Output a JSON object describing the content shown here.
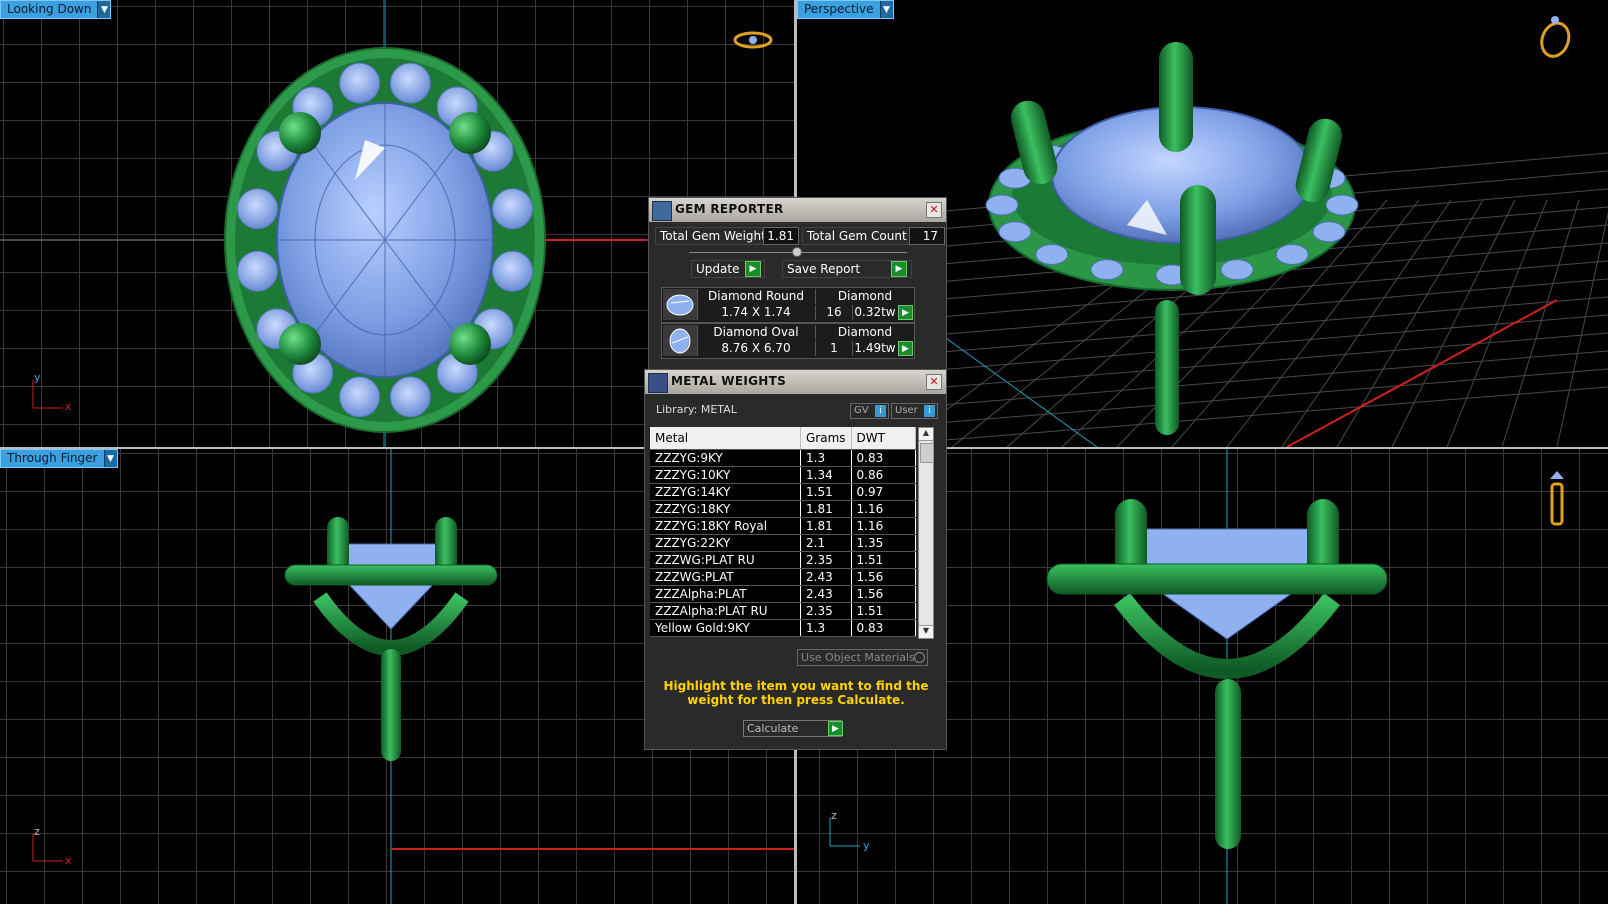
{
  "viewports": {
    "top_left": {
      "label": "Looking Down",
      "axes": [
        "y",
        "x"
      ]
    },
    "top_right": {
      "label": "Perspective"
    },
    "bottom_left": {
      "label": "Through Finger",
      "axes": [
        "z",
        "x"
      ]
    },
    "bottom_right": {
      "axes": [
        "z",
        "y"
      ]
    }
  },
  "gem_reporter": {
    "title": "GEM REPORTER",
    "total_weight_label": "Total Gem Weight",
    "total_weight_value": "1.81",
    "total_count_label": "Total Gem Count",
    "total_count_value": "17",
    "update_label": "Update",
    "save_label": "Save Report",
    "gems": [
      {
        "shape": "Diamond Round",
        "material": "Diamond",
        "size": "1.74 X 1.74",
        "count": "16",
        "weight": "0.32tw"
      },
      {
        "shape": "Diamond Oval",
        "material": "Diamond",
        "size": "8.76 X 6.70",
        "count": "1",
        "weight": "1.49tw"
      }
    ]
  },
  "metal_weights": {
    "title": "METAL WEIGHTS",
    "library_label": "Library: METAL",
    "gv_label": "GV",
    "user_label": "User",
    "columns": [
      "Metal",
      "Grams",
      "DWT"
    ],
    "rows": [
      {
        "metal": "ZZZYG:9KY",
        "grams": "1.3",
        "dwt": "0.83"
      },
      {
        "metal": "ZZZYG:10KY",
        "grams": "1.34",
        "dwt": "0.86"
      },
      {
        "metal": "ZZZYG:14KY",
        "grams": "1.51",
        "dwt": "0.97"
      },
      {
        "metal": "ZZZYG:18KY",
        "grams": "1.81",
        "dwt": "1.16"
      },
      {
        "metal": "ZZZYG:18KY Royal",
        "grams": "1.81",
        "dwt": "1.16"
      },
      {
        "metal": "ZZZYG:22KY",
        "grams": "2.1",
        "dwt": "1.35"
      },
      {
        "metal": "ZZZWG:PLAT RU",
        "grams": "2.35",
        "dwt": "1.51"
      },
      {
        "metal": "ZZZWG:PLAT",
        "grams": "2.43",
        "dwt": "1.56"
      },
      {
        "metal": "ZZZAlpha:PLAT",
        "grams": "2.43",
        "dwt": "1.56"
      },
      {
        "metal": "ZZZAlpha:PLAT RU",
        "grams": "2.35",
        "dwt": "1.51"
      },
      {
        "metal": "Yellow Gold:9KY",
        "grams": "1.3",
        "dwt": "0.83"
      }
    ],
    "use_object_label": "Use Object Materials",
    "hint": "Highlight the item you want to find the weight for then press Calculate.",
    "calculate_label": "Calculate"
  },
  "colors": {
    "metal_green": "#2f9a4a",
    "gem_blue": "#8fb1f0",
    "highlight_yellow": "#ffd200",
    "viewport_label": "#3aa0e0"
  }
}
